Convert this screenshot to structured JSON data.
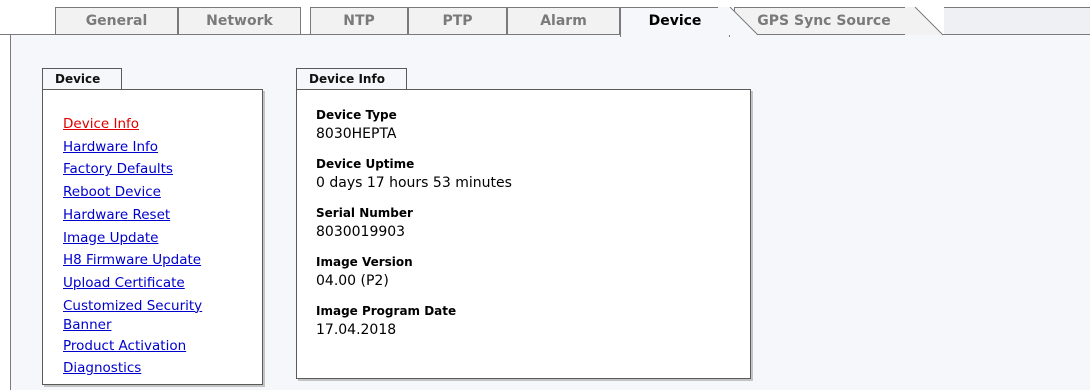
{
  "tabs": [
    {
      "label": "General"
    },
    {
      "label": "Network"
    },
    {
      "label": "NTP"
    },
    {
      "label": "PTP"
    },
    {
      "label": "Alarm"
    },
    {
      "label": "Device"
    },
    {
      "label": "GPS Sync Source"
    }
  ],
  "active_tab": "Device",
  "device_panel": {
    "title": "Device",
    "items": [
      "Device Info",
      "Hardware Info",
      "Factory Defaults",
      "Reboot Device",
      "Hardware Reset",
      "Image Update",
      "H8 Firmware Update",
      "Upload Certificate",
      "Customized Security",
      "Banner",
      "Product Activation",
      "Diagnostics"
    ],
    "active_item": "Device Info"
  },
  "info_panel": {
    "title": "Device Info",
    "fields": [
      {
        "label": "Device Type",
        "value": "8030HEPTA"
      },
      {
        "label": "Device Uptime",
        "value": "0 days 17 hours 53 minutes"
      },
      {
        "label": "Serial Number",
        "value": "8030019903"
      },
      {
        "label": "Image Version",
        "value": "04.00 (P2)"
      },
      {
        "label": "Image Program Date",
        "value": "17.04.2018"
      }
    ]
  },
  "colors": {
    "link": "#0000cc",
    "active_link": "#e00000",
    "content_bg": "#f5f7fb",
    "tab_inactive_text": "#7a7a7a"
  }
}
